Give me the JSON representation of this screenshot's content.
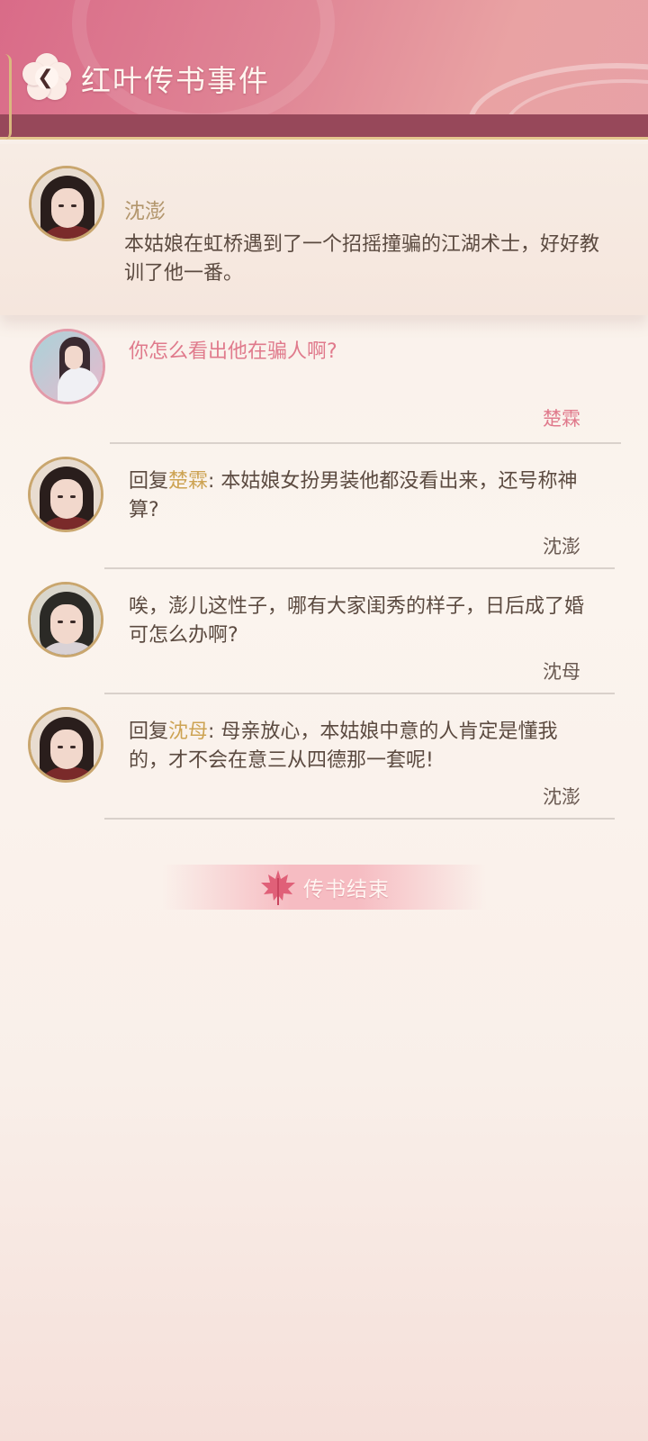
{
  "header": {
    "title": "红叶传书事件",
    "back_icon": "chevron-left-icon"
  },
  "post": {
    "author": "沈澎",
    "text": "本姑娘在虹桥遇到了一个招摇撞骗的江湖术士，好好教训了他一番。"
  },
  "comments": [
    {
      "text": "你怎么看出他在骗人啊?",
      "author": "楚霖"
    },
    {
      "reply_prefix": "回复",
      "reply_to": "楚霖",
      "text": ": 本姑娘女扮男装他都没看出来，还号称神算?",
      "author": "沈澎"
    },
    {
      "text": "唉，澎儿这性子，哪有大家闺秀的样子，日后成了婚可怎么办啊?",
      "author": "沈母"
    },
    {
      "reply_prefix": "回复",
      "reply_to": "沈母",
      "text": ": 母亲放心，本姑娘中意的人肯定是懂我的，才不会在意三从四德那一套呢!",
      "author": "沈澎"
    }
  ],
  "end_button": {
    "label": "传书结束",
    "icon": "maple-leaf-icon"
  },
  "colors": {
    "header_pink": "#d96b88",
    "accent_gold": "#cda353",
    "reply_pink": "#e07a8c"
  }
}
